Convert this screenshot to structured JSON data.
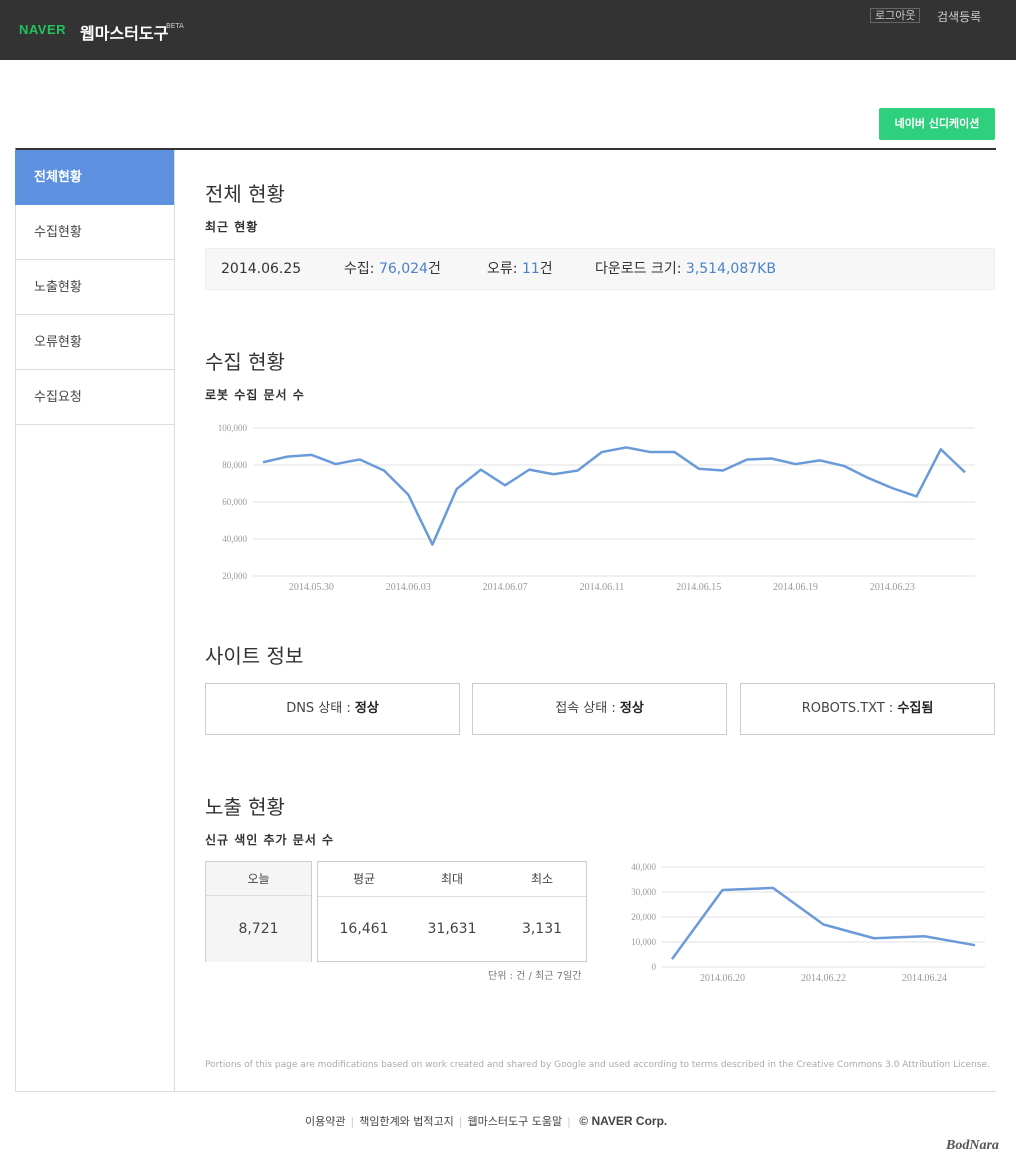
{
  "header": {
    "brand": "NAVER",
    "app_name": "웹마스터도구",
    "beta": "BETA",
    "logout_label": "로그아웃",
    "search_register_label": "검색등록"
  },
  "syndication_button": "네이버 신디케이션",
  "sidebar": {
    "items": [
      {
        "label": "전체현황",
        "active": true
      },
      {
        "label": "수집현황",
        "active": false
      },
      {
        "label": "노출현황",
        "active": false
      },
      {
        "label": "오류현황",
        "active": false
      },
      {
        "label": "수집요청",
        "active": false
      }
    ]
  },
  "overview": {
    "title": "전체 현황",
    "subtitle": "최근 현황",
    "date": "2014.06.25",
    "crawl_label": "수집:",
    "crawl_value": "76,024",
    "crawl_unit": "건",
    "error_label": "오류:",
    "error_value": "11",
    "error_unit": "건",
    "download_label": "다운로드 크기:",
    "download_value": "3,514,087KB"
  },
  "crawl": {
    "title": "수집 현황",
    "subtitle": "로봇 수집 문서 수"
  },
  "site_info": {
    "title": "사이트 정보",
    "dns_label": "DNS 상태 :",
    "dns_value": "정상",
    "access_label": "접속 상태 :",
    "access_value": "정상",
    "robots_label": "ROBOTS.TXT :",
    "robots_value": "수집됨"
  },
  "exposure": {
    "title": "노출 현황",
    "subtitle": "신규 색인 추가 문서 수",
    "today_label": "오늘",
    "today_value": "8,721",
    "avg_label": "평균",
    "avg_value": "16,461",
    "max_label": "최대",
    "max_value": "31,631",
    "min_label": "최소",
    "min_value": "3,131",
    "unit_note": "단위 : 건 / 최근 7일간"
  },
  "license_text": "Portions of this page are modifications based on work created and shared by Google and used according to terms described in the Creative Commons 3.0 Attribution License.",
  "footer": {
    "terms": "이용약관",
    "disclaimer": "책임한계와 법적고지",
    "help": "웹마스터도구 도움말",
    "copyright": "© NAVER Corp."
  },
  "watermark": "BodNara",
  "colors": {
    "topbar": "#333333",
    "brand_green": "#21c25e",
    "accent_blue": "#5d91df",
    "line_blue": "#6a9ad8",
    "syndication_green": "#2ecf7d"
  },
  "chart_data": [
    {
      "type": "line",
      "ylim": [
        20000,
        100000
      ],
      "yticks": [
        "20,000",
        "40,000",
        "60,000",
        "80,000",
        "100,000"
      ],
      "xtick_labels": [
        "2014.05.30",
        "2014.06.03",
        "2014.06.07",
        "2014.06.11",
        "2014.06.15",
        "2014.06.19",
        "2014.06.23"
      ],
      "x": [
        "2014.05.28",
        "2014.05.29",
        "2014.05.30",
        "2014.05.31",
        "2014.06.01",
        "2014.06.02",
        "2014.06.03",
        "2014.06.04",
        "2014.06.05",
        "2014.06.06",
        "2014.06.07",
        "2014.06.08",
        "2014.06.09",
        "2014.06.10",
        "2014.06.11",
        "2014.06.12",
        "2014.06.13",
        "2014.06.14",
        "2014.06.15",
        "2014.06.16",
        "2014.06.17",
        "2014.06.18",
        "2014.06.19",
        "2014.06.20",
        "2014.06.21",
        "2014.06.22",
        "2014.06.23",
        "2014.06.24",
        "2014.06.25"
      ],
      "values": [
        81500,
        84500,
        85500,
        80500,
        83000,
        77000,
        64000,
        37000,
        67000,
        77500,
        69000,
        77500,
        75000,
        77000,
        87000,
        89500,
        87000,
        87000,
        78000,
        77000,
        83000,
        83500,
        80500,
        82500,
        79500,
        73000,
        67500,
        63000,
        88500,
        76000
      ],
      "grid": true
    },
    {
      "type": "line",
      "ylim": [
        0,
        40000
      ],
      "yticks": [
        "0",
        "10,000",
        "20,000",
        "30,000",
        "40,000"
      ],
      "xtick_labels": [
        "2014.06.20",
        "2014.06.22",
        "2014.06.24"
      ],
      "x": [
        "2014.06.19",
        "2014.06.20",
        "2014.06.21",
        "2014.06.22",
        "2014.06.23",
        "2014.06.24",
        "2014.06.25"
      ],
      "values": [
        3131,
        30800,
        31631,
        17000,
        11500,
        12300,
        8721
      ],
      "grid": true
    }
  ]
}
